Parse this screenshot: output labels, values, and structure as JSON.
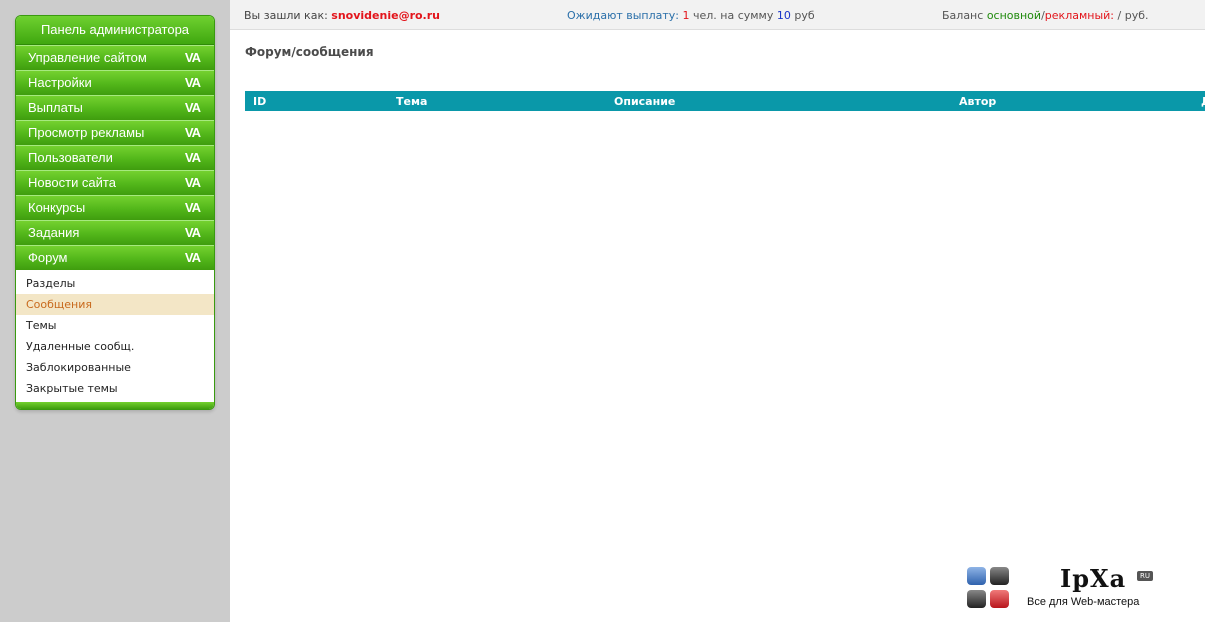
{
  "sidebar": {
    "title": "Панель администратора",
    "chevron": "VA",
    "items": [
      {
        "label": "Управление сайтом"
      },
      {
        "label": "Настройки"
      },
      {
        "label": "Выплаты"
      },
      {
        "label": "Просмотр рекламы"
      },
      {
        "label": "Пользователи"
      },
      {
        "label": "Новости сайта"
      },
      {
        "label": "Конкурсы"
      },
      {
        "label": "Задания"
      },
      {
        "label": "Форум"
      }
    ],
    "submenu": [
      {
        "label": "Разделы"
      },
      {
        "label": "Сообщения"
      },
      {
        "label": "Темы"
      },
      {
        "label": "Удаленные сообщ."
      },
      {
        "label": "Заблокированные"
      },
      {
        "label": "Закрытые темы"
      }
    ]
  },
  "topbar": {
    "login_prefix": "Вы зашли как:",
    "login_user": "snovidenie@ro.ru",
    "wait_label": "Ожидают выплату:",
    "wait_count": "1",
    "wait_mid": "чел. на сумму",
    "wait_sum": "10",
    "wait_currency": "руб",
    "balance_label": "Баланс",
    "balance_main": "основной",
    "balance_sep": "/",
    "balance_ads": "рекламный",
    "balance_colon": ":",
    "balance_value": "/ руб."
  },
  "main": {
    "title": "Форум/сообщения",
    "table": {
      "columns": [
        "ID",
        "Тема",
        "Описание",
        "Автор",
        "Д"
      ]
    }
  },
  "logo": {
    "name": "IpXa",
    "badge": "RU",
    "tagline": "Все для Web-мастера"
  },
  "colors": {
    "accent_green": "#52b61a",
    "table_header": "#0a98a9",
    "user_red": "#e3141b",
    "active_sub_bg": "#f3e6c6"
  }
}
